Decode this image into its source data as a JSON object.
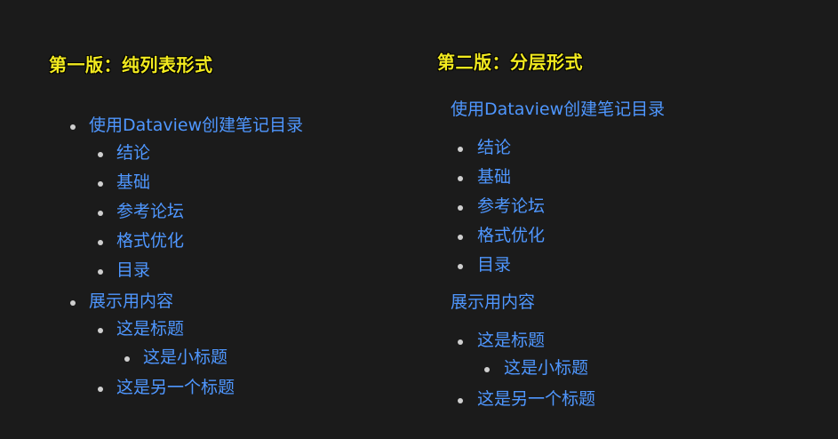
{
  "left": {
    "title": "第一版：纯列表形式",
    "items": {
      "dataview": "使用Dataview创建笔记目录",
      "conclusion": "结论",
      "basics": "基础",
      "forum": "参考论坛",
      "format": "格式优化",
      "toc": "目录",
      "display": "展示用内容",
      "heading": "这是标题",
      "subheading": "这是小标题",
      "another_heading": "这是另一个标题"
    }
  },
  "right": {
    "title": "第二版：分层形式",
    "items": {
      "dataview": "使用Dataview创建笔记目录",
      "conclusion": "结论",
      "basics": "基础",
      "forum": "参考论坛",
      "format": "格式优化",
      "toc": "目录",
      "display": "展示用内容",
      "heading": "这是标题",
      "subheading": "这是小标题",
      "another_heading": "这是另一个标题"
    }
  }
}
